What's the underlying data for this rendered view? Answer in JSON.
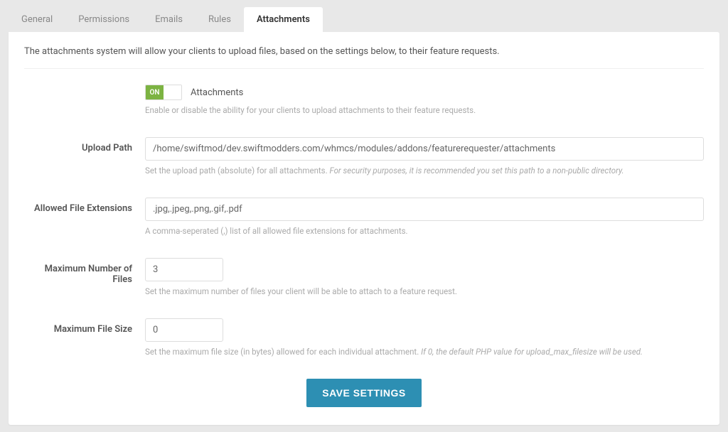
{
  "tabs": {
    "general": "General",
    "permissions": "Permissions",
    "emails": "Emails",
    "rules": "Rules",
    "attachments": "Attachments"
  },
  "intro": "The attachments system will allow your clients to upload files, based on the settings below, to their feature requests.",
  "toggle": {
    "on_text": "ON",
    "label": "Attachments",
    "help": "Enable or disable the ability for your clients to upload attachments to their feature requests."
  },
  "upload_path": {
    "label": "Upload Path",
    "value": "/home/swiftmod/dev.swiftmodders.com/whmcs/modules/addons/featurerequester/attachments",
    "help_plain": "Set the upload path (absolute) for all attachments. ",
    "help_italic": "For security purposes, it is recommended you set this path to a non-public directory."
  },
  "allowed_ext": {
    "label": "Allowed File Extensions",
    "value": ".jpg,.jpeg,.png,.gif,.pdf",
    "help": "A comma-seperated (,) list of all allowed file extensions for attachments."
  },
  "max_files": {
    "label": "Maximum Number of Files",
    "value": "3",
    "help": "Set the maximum number of files your client will be able to attach to a feature request."
  },
  "max_size": {
    "label": "Maximum File Size",
    "value": "0",
    "help_plain": "Set the maximum file size (in bytes) allowed for each individual attachment. ",
    "help_italic": "If 0, the default PHP value for upload_max_filesize will be used."
  },
  "save_button": "SAVE SETTINGS"
}
